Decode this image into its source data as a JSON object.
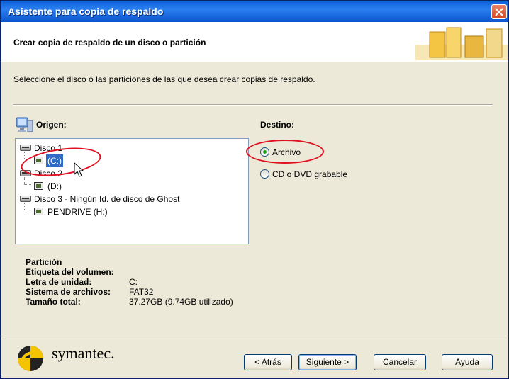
{
  "window": {
    "title": "Asistente para copia de respaldo"
  },
  "header": {
    "title": "Crear copia de respaldo de un disco o partición"
  },
  "instruction": "Seleccione el disco o las particiones de las que desea crear copias de respaldo.",
  "origin": {
    "label": "Origen:",
    "tree": [
      {
        "label": "Disco 1"
      },
      {
        "label": "(C:)"
      },
      {
        "label": "Disco 2"
      },
      {
        "label": "(D:)"
      },
      {
        "label": "Disco 3 - Ningún Id. de disco de Ghost"
      },
      {
        "label": "PENDRIVE (H:)"
      }
    ]
  },
  "destination": {
    "label": "Destino:",
    "options": [
      {
        "label": "Archivo",
        "selected": true
      },
      {
        "label": "CD o DVD grabable",
        "selected": false
      }
    ]
  },
  "info": {
    "section": "Partición",
    "rows": [
      {
        "key": "Etiqueta del volumen:",
        "value": ""
      },
      {
        "key": "Letra de unidad:",
        "value": "C:"
      },
      {
        "key": "Sistema de archivos:",
        "value": "FAT32"
      },
      {
        "key": "Tamaño total:",
        "value": "37.27GB (9.74GB utilizado)"
      }
    ]
  },
  "footer": {
    "brand": "symantec.",
    "buttons": {
      "back": "< Atrás",
      "next": "Siguiente >",
      "cancel": "Cancelar",
      "help": "Ayuda"
    }
  },
  "colors": {
    "titlebar": "#0a5fd8",
    "annotation": "#e01020",
    "selection": "#316ac5"
  }
}
